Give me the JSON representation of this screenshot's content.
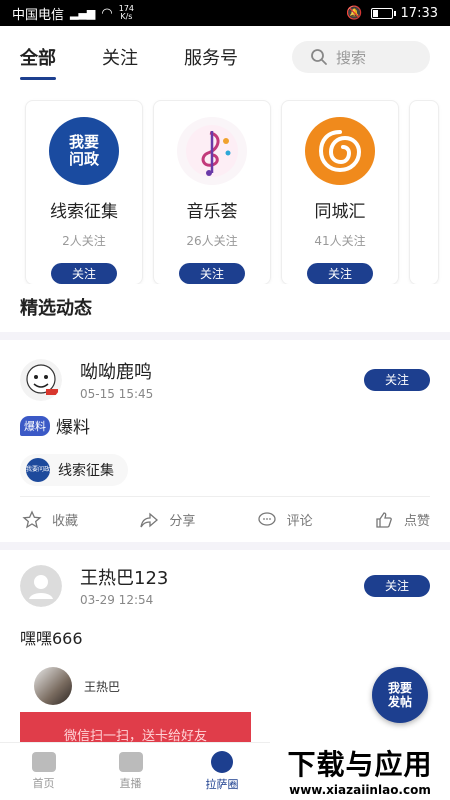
{
  "status_bar": {
    "carrier": "中国电信",
    "network": "4G",
    "speed_value": "174",
    "speed_unit": "K/s",
    "time": "17:33"
  },
  "top_tabs": [
    {
      "label": "全部",
      "active": true
    },
    {
      "label": "关注",
      "active": false
    },
    {
      "label": "服务号",
      "active": false
    }
  ],
  "search": {
    "placeholder": "搜索"
  },
  "service_cards": [
    {
      "name": "线索征集",
      "followers": "2人关注",
      "button": "关注",
      "logo_text_1": "我要",
      "logo_text_2": "问政"
    },
    {
      "name": "音乐荟",
      "followers": "26人关注",
      "button": "关注"
    },
    {
      "name": "同城汇",
      "followers": "41人关注",
      "button": "关注"
    }
  ],
  "section_title": "精选动态",
  "posts": [
    {
      "user": "呦呦鹿鸣",
      "time": "05-15 15:45",
      "follow": "关注",
      "tag": "爆料",
      "content": "爆料",
      "topic": "线索征集",
      "topic_logo_text": "我要问政",
      "actions": {
        "collect": "收藏",
        "share": "分享",
        "comment": "评论",
        "like": "点赞"
      }
    },
    {
      "user": "王热巴123",
      "time": "03-29 12:54",
      "follow": "关注",
      "content": "嘿嘿666",
      "shared_user": "王热巴",
      "shared_banner": "微信扫一扫，送卡给好友"
    }
  ],
  "fab": {
    "line1": "我要",
    "line2": "发帖"
  },
  "bottom_nav": [
    {
      "label": "首页",
      "icon": "home-icon",
      "active": false
    },
    {
      "label": "直播",
      "icon": "video-icon",
      "active": false
    },
    {
      "label": "拉萨圈",
      "icon": "chat-icon",
      "active": true
    }
  ],
  "watermark": {
    "title": "下载与应用",
    "url": "www.xiazaiinlao.com"
  },
  "colors": {
    "primary": "#1d3f8f",
    "divider": "#f4f3f8"
  }
}
